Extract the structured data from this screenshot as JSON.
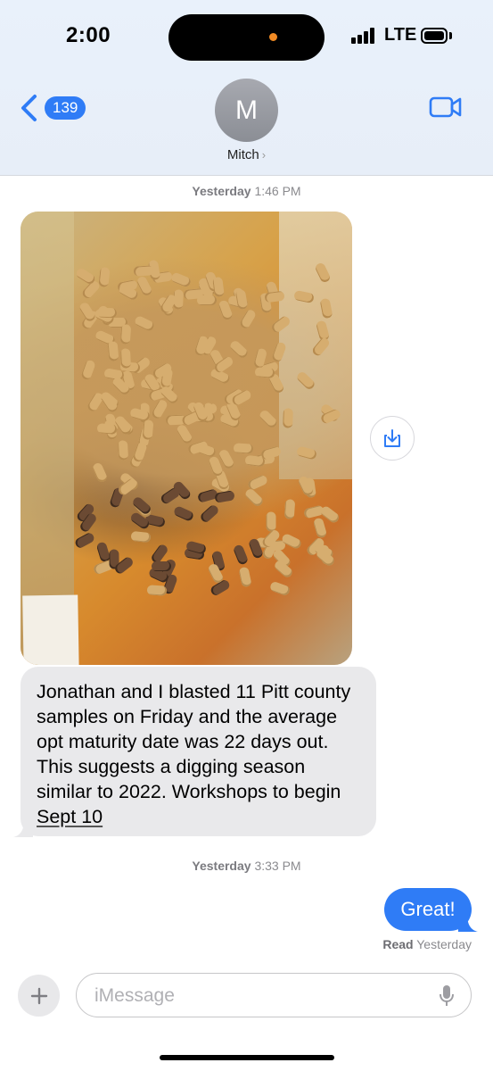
{
  "status_bar": {
    "time": "2:00",
    "network": "LTE"
  },
  "header": {
    "back_count": "139",
    "avatar_initial": "M",
    "contact_name": "Mitch"
  },
  "thread": {
    "timestamp1": {
      "day": "Yesterday",
      "time": "1:46 PM"
    },
    "photo_alt": "Peanut samples photo",
    "incoming_message": {
      "text": "Jonathan and I blasted 11 Pitt county samples on Friday and the average opt maturity date was 22 days out. This suggests a digging season similar to 2022. Workshops to begin",
      "link_text": "Sept 10"
    },
    "timestamp2": {
      "day": "Yesterday",
      "time": "3:33 PM"
    },
    "outgoing_message": {
      "text": "Great!"
    },
    "read_receipt": {
      "label": "Read",
      "when": "Yesterday"
    }
  },
  "composer": {
    "placeholder": "iMessage"
  },
  "colors": {
    "accent": "#2f7cf6",
    "incoming_bubble": "#e9e9eb"
  },
  "icons": {
    "back": "chevron-left-icon",
    "video": "video-camera-icon",
    "save": "download-icon",
    "add": "plus-icon",
    "mic": "microphone-icon"
  }
}
